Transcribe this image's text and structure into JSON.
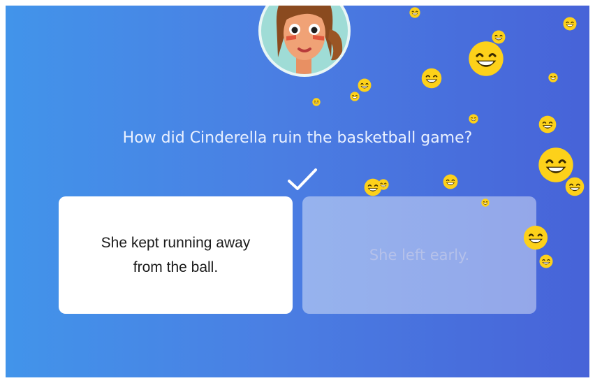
{
  "question": "How did Cinderella ruin the basketball game?",
  "answers": [
    {
      "text": "She kept running away from the ball.",
      "state": "correct"
    },
    {
      "text": "She left early.",
      "state": "dimmed"
    }
  ],
  "colors": {
    "background_left": "#4294ea",
    "background_right": "#4763d8",
    "emoji_yellow": "#fdd11a",
    "check": "#ffffff"
  },
  "icons": {
    "character": "girl-avatar-icon",
    "reaction": "grinning-face-emoji",
    "correct": "checkmark-icon"
  }
}
